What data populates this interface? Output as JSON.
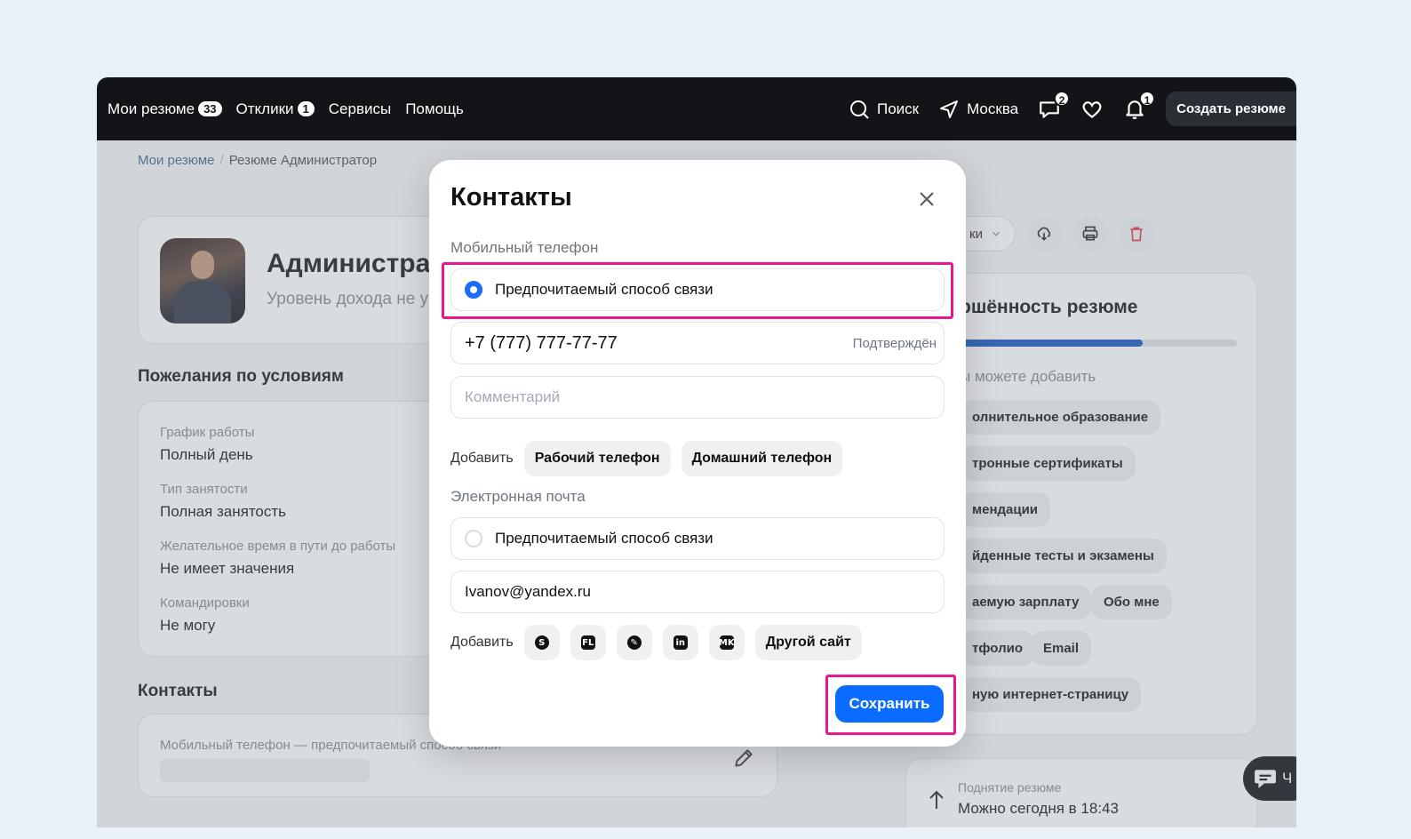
{
  "nav": {
    "my_resumes": "Мои резюме",
    "my_resumes_count": "33",
    "responses": "Отклики",
    "responses_count": "1",
    "services": "Сервисы",
    "help": "Помощь",
    "search": "Поиск",
    "city": "Москва",
    "messages_count": "2",
    "notifications_count": "1",
    "create_resume": "Создать резюме"
  },
  "breadcrumb": {
    "root": "Мои резюме",
    "separator": "/",
    "current": "Резюме Администратор"
  },
  "resume": {
    "title": "Администратор",
    "subtitle": "Уровень дохода не указан"
  },
  "conditions": {
    "title": "Пожелания по условиям",
    "fields": [
      {
        "label": "График работы",
        "value": "Полный день"
      },
      {
        "label": "Тип занятости",
        "value": "Полная занятость"
      },
      {
        "label": "Желательное время в пути до работы",
        "value": "Не имеет значения"
      },
      {
        "label": "Командировки",
        "value": "Не могу"
      }
    ]
  },
  "contacts_section": {
    "title": "Контакты",
    "line": "Мобильный телефон — предпочитаемый способ связи"
  },
  "right_panel": {
    "select_label": "ки",
    "completion_title": "ршённость резюме",
    "progress": 0.66,
    "hint": "ы можете добавить",
    "chips": [
      "олнительное образование",
      "тронные сертификаты",
      "мендации",
      "йденные тесты и экзамены",
      "аемую зарплату",
      "Обо мне",
      "тфолио",
      "Email",
      "ную интернет-страницу"
    ],
    "raise_label": "Поднятие резюме",
    "raise_value": "Можно сегодня в 18:43",
    "chat_label": "Ч"
  },
  "modal": {
    "title": "Контакты",
    "mobile_label": "Мобильный телефон",
    "preferred_label": "Предпочитаемый способ связи",
    "phone_value": "+7 (777) 777-77-77",
    "confirmed": "Подтверждён",
    "comment_placeholder": "Комментарий",
    "add_label": "Добавить",
    "work_phone": "Рабочий телефон",
    "home_phone": "Домашний телефон",
    "email_label": "Электронная почта",
    "email_preferred_label": "Предпочитаемый способ связи",
    "email_value": "Ivanov@yandex.ru",
    "add_label_2": "Добавить",
    "other_site": "Другой сайт",
    "save": "Сохранить"
  },
  "colors": {
    "accent": "#0a6cff",
    "highlight": "#e8178c",
    "topbar": "#121417"
  }
}
